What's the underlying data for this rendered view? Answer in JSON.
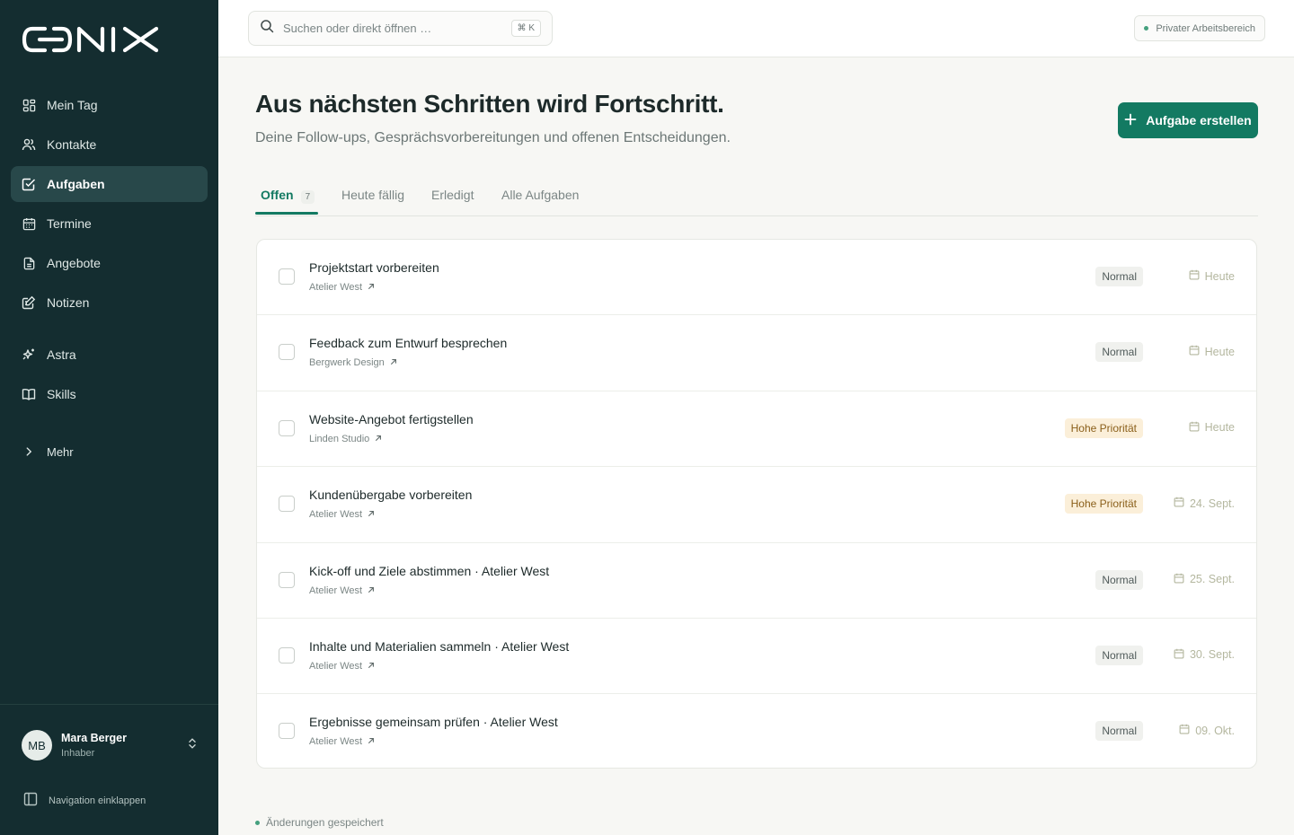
{
  "brand": {
    "logo_text": "CONIX"
  },
  "sidebar": {
    "items": [
      {
        "label": "Mein Tag",
        "icon": "grid-icon"
      },
      {
        "label": "Kontakte",
        "icon": "users-icon"
      },
      {
        "label": "Aufgaben",
        "icon": "check-square-icon",
        "active": true
      },
      {
        "label": "Termine",
        "icon": "calendar-icon"
      },
      {
        "label": "Angebote",
        "icon": "document-icon"
      },
      {
        "label": "Notizen",
        "icon": "note-icon"
      }
    ],
    "secondary": [
      {
        "label": "Astra",
        "icon": "sparkle-icon"
      },
      {
        "label": "Skills",
        "icon": "book-icon"
      }
    ],
    "more_label": "Mehr",
    "user": {
      "initials": "MB",
      "name": "Mara Berger",
      "role": "Inhaber"
    },
    "collapse_label": "Navigation einklappen"
  },
  "topbar": {
    "search_placeholder": "Suchen oder direkt öffnen …",
    "shortcut": "⌘ K",
    "workspace": "Privater Arbeitsbereich"
  },
  "page": {
    "title": "Aus nächsten Schritten wird Fortschritt.",
    "subtitle": "Deine Follow-ups, Gesprächsvorbereitungen und offenen Entscheidungen.",
    "create_button": "Aufgabe erstellen"
  },
  "tabs": [
    {
      "label": "Offen",
      "count": "7",
      "active": true
    },
    {
      "label": "Heute fällig"
    },
    {
      "label": "Erledigt"
    },
    {
      "label": "Alle Aufgaben"
    }
  ],
  "tasks": [
    {
      "title": "Projektstart vorbereiten",
      "company": "Atelier West",
      "priority": "Normal",
      "priority_level": "normal",
      "due": "Heute"
    },
    {
      "title": "Feedback zum Entwurf besprechen",
      "company": "Bergwerk Design",
      "priority": "Normal",
      "priority_level": "normal",
      "due": "Heute"
    },
    {
      "title": "Website-Angebot fertigstellen",
      "company": "Linden Studio",
      "priority": "Hohe Priorität",
      "priority_level": "high",
      "due": "Heute"
    },
    {
      "title": "Kundenübergabe vorbereiten",
      "company": "Atelier West",
      "priority": "Hohe Priorität",
      "priority_level": "high",
      "due": "24. Sept."
    },
    {
      "title": "Kick-off und Ziele abstimmen · Atelier West",
      "company": "Atelier West",
      "priority": "Normal",
      "priority_level": "normal",
      "due": "25. Sept."
    },
    {
      "title": "Inhalte und Materialien sammeln · Atelier West",
      "company": "Atelier West",
      "priority": "Normal",
      "priority_level": "normal",
      "due": "30. Sept."
    },
    {
      "title": "Ergebnisse gemeinsam prüfen · Atelier West",
      "company": "Atelier West",
      "priority": "Normal",
      "priority_level": "normal",
      "due": "09. Okt."
    }
  ],
  "status": {
    "saved": "Änderungen gespeichert"
  },
  "colors": {
    "sidebar": "#142d30",
    "accent": "#137a62",
    "high_priority_bg": "#fbefd9",
    "high_priority_text": "#8a5f1a"
  }
}
